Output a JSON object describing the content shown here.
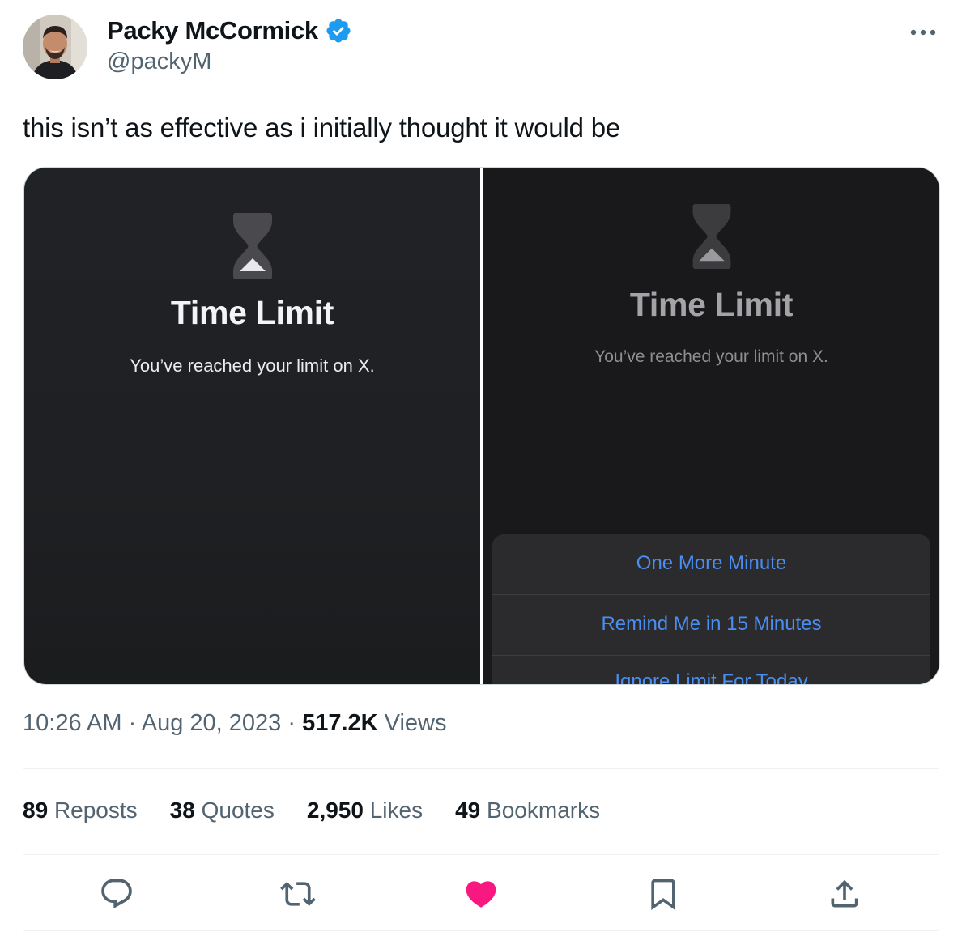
{
  "author": {
    "name": "Packy McCormick",
    "handle": "@packyM",
    "verified_icon": "verified-badge-icon",
    "verified_color": "#1d9bf0"
  },
  "tweet": {
    "text": "this isn’t as effective as i initially thought it would be"
  },
  "media": {
    "left": {
      "title": "Time Limit",
      "subtitle": "You’ve reached your limit on X."
    },
    "right": {
      "title": "Time Limit",
      "subtitle": "You’ve reached your limit on X.",
      "options": [
        "One More Minute",
        "Remind Me in 15 Minutes",
        "Ignore Limit For Today"
      ]
    }
  },
  "meta": {
    "time": "10:26 AM",
    "sep1": "·",
    "date": "Aug 20, 2023",
    "sep2": "·",
    "views_count": "517.2K",
    "views_label": "Views"
  },
  "stats": [
    {
      "count": "89",
      "label": "Reposts"
    },
    {
      "count": "38",
      "label": "Quotes"
    },
    {
      "count": "2,950",
      "label": "Likes"
    },
    {
      "count": "49",
      "label": "Bookmarks"
    }
  ],
  "actions": {
    "icons": [
      "reply-icon",
      "repost-icon",
      "like-icon",
      "bookmark-icon",
      "share-icon"
    ],
    "like_color": "#f91880",
    "icon_color": "#536471"
  }
}
